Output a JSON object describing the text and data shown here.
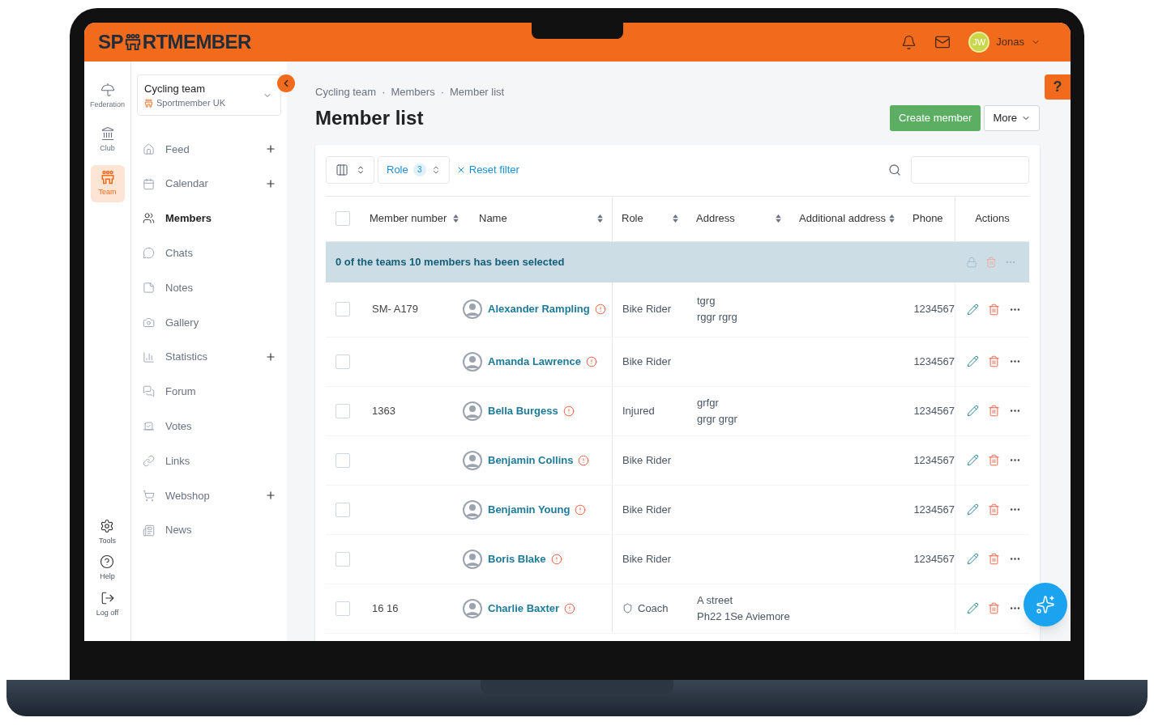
{
  "header": {
    "logo_parts": [
      "SP",
      "RTMEMBER"
    ],
    "user_initials": "JW",
    "user_name": "Jonas"
  },
  "rail": {
    "top": [
      {
        "label": "Federation",
        "selected": false
      },
      {
        "label": "Club",
        "selected": false
      },
      {
        "label": "Team",
        "selected": true
      }
    ],
    "bottom": [
      {
        "label": "Tools"
      },
      {
        "label": "Help"
      },
      {
        "label": "Log off"
      }
    ]
  },
  "nav": {
    "org_name": "Cycling team",
    "org_sub": "Sportmember UK",
    "items": [
      {
        "label": "Feed",
        "selected": false,
        "addable": true
      },
      {
        "label": "Calendar",
        "selected": false,
        "addable": true
      },
      {
        "label": "Members",
        "selected": true,
        "addable": false
      },
      {
        "label": "Chats",
        "selected": false,
        "addable": false
      },
      {
        "label": "Notes",
        "selected": false,
        "addable": false
      },
      {
        "label": "Gallery",
        "selected": false,
        "addable": false
      },
      {
        "label": "Statistics",
        "selected": false,
        "addable": true
      },
      {
        "label": "Forum",
        "selected": false,
        "addable": false
      },
      {
        "label": "Votes",
        "selected": false,
        "addable": false
      },
      {
        "label": "Links",
        "selected": false,
        "addable": false
      },
      {
        "label": "Webshop",
        "selected": false,
        "addable": true
      },
      {
        "label": "News",
        "selected": false,
        "addable": false
      }
    ]
  },
  "breadcrumb": [
    "Cycling team",
    "Members",
    "Member list"
  ],
  "breadcrumb_separator": "·",
  "title": "Member list",
  "buttons": {
    "create": "Create member",
    "more": "More"
  },
  "help_tab": "?",
  "filters": {
    "role_label": "Role",
    "role_count": "3",
    "reset": "Reset filter"
  },
  "table": {
    "all_selected": false,
    "columns": [
      {
        "label": "Member number",
        "sortable": true
      },
      {
        "label": "Name",
        "sortable": true
      },
      {
        "label": "Role",
        "sortable": true
      },
      {
        "label": "Address",
        "sortable": true
      },
      {
        "label": "Additional address",
        "sortable": true
      },
      {
        "label": "Phone",
        "sortable": false
      },
      {
        "label": "Actions",
        "sortable": false
      }
    ],
    "selection_text": "0 of the teams 10 members has been selected",
    "rows": [
      {
        "selected": false,
        "member_number": "SM- A179",
        "name": "Alexander Rampling",
        "role": "Bike Rider",
        "shield": false,
        "address": [
          "tgrg",
          "rggr rgrg"
        ],
        "phone": "1234567"
      },
      {
        "selected": false,
        "name": "Amanda Lawrence",
        "role": "Bike Rider",
        "shield": false,
        "address": [],
        "phone": "1234567"
      },
      {
        "selected": false,
        "member_number": "1363",
        "name": "Bella Burgess",
        "role": "Injured",
        "shield": false,
        "address": [
          "grfgr",
          "grgr grgr"
        ],
        "phone": "1234567"
      },
      {
        "selected": false,
        "name": "Benjamin Collins",
        "role": "Bike Rider",
        "shield": false,
        "address": [],
        "phone": "1234567"
      },
      {
        "selected": false,
        "name": "Benjamin Young",
        "role": "Bike Rider",
        "shield": false,
        "address": [],
        "phone": "1234567"
      },
      {
        "selected": false,
        "name": "Boris Blake",
        "role": "Bike Rider",
        "shield": false,
        "address": [],
        "phone": "1234567"
      },
      {
        "selected": false,
        "member_number": "16 16",
        "name": "Charlie Baxter",
        "role": "Coach",
        "shield": true,
        "address": [
          "A street",
          "Ph22 1Se Aviemore"
        ]
      }
    ]
  }
}
